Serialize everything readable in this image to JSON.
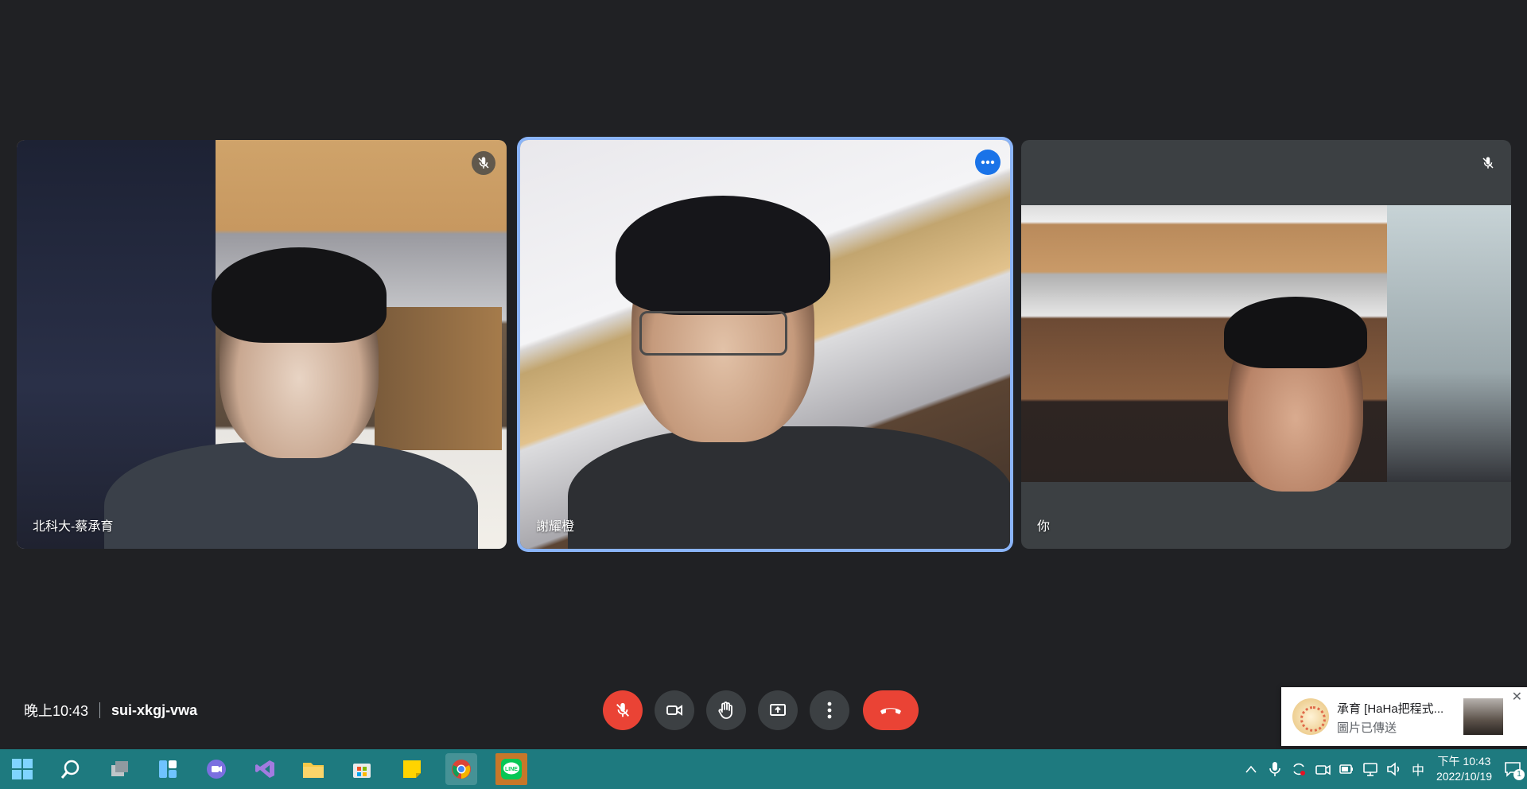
{
  "meeting": {
    "time": "晚上10:43",
    "code": "sui-xkgj-vwa"
  },
  "participants": [
    {
      "name": "北科大-蔡承育",
      "muted": true
    },
    {
      "name": "謝耀橙",
      "muted": false,
      "speaking_frame": true
    },
    {
      "name": "你",
      "muted": true
    }
  ],
  "controls": {
    "mic": "mic-off-icon",
    "camera": "videocam-icon",
    "hand": "raise-hand-icon",
    "present": "present-screen-icon",
    "more": "more-vert-icon",
    "end": "call-end-icon"
  },
  "notification": {
    "title": "承育 [HaHa把程式...",
    "message": "圖片已傳送"
  },
  "taskbar": {
    "clock_time": "下午 10:43",
    "clock_date": "2022/10/19",
    "ime": "中",
    "notification_count": "1"
  },
  "colors": {
    "background": "#202124",
    "tile": "#3c4043",
    "accent_blue": "#8ab4f8",
    "danger_red": "#ea4335",
    "taskbar": "#1e7a7f"
  }
}
